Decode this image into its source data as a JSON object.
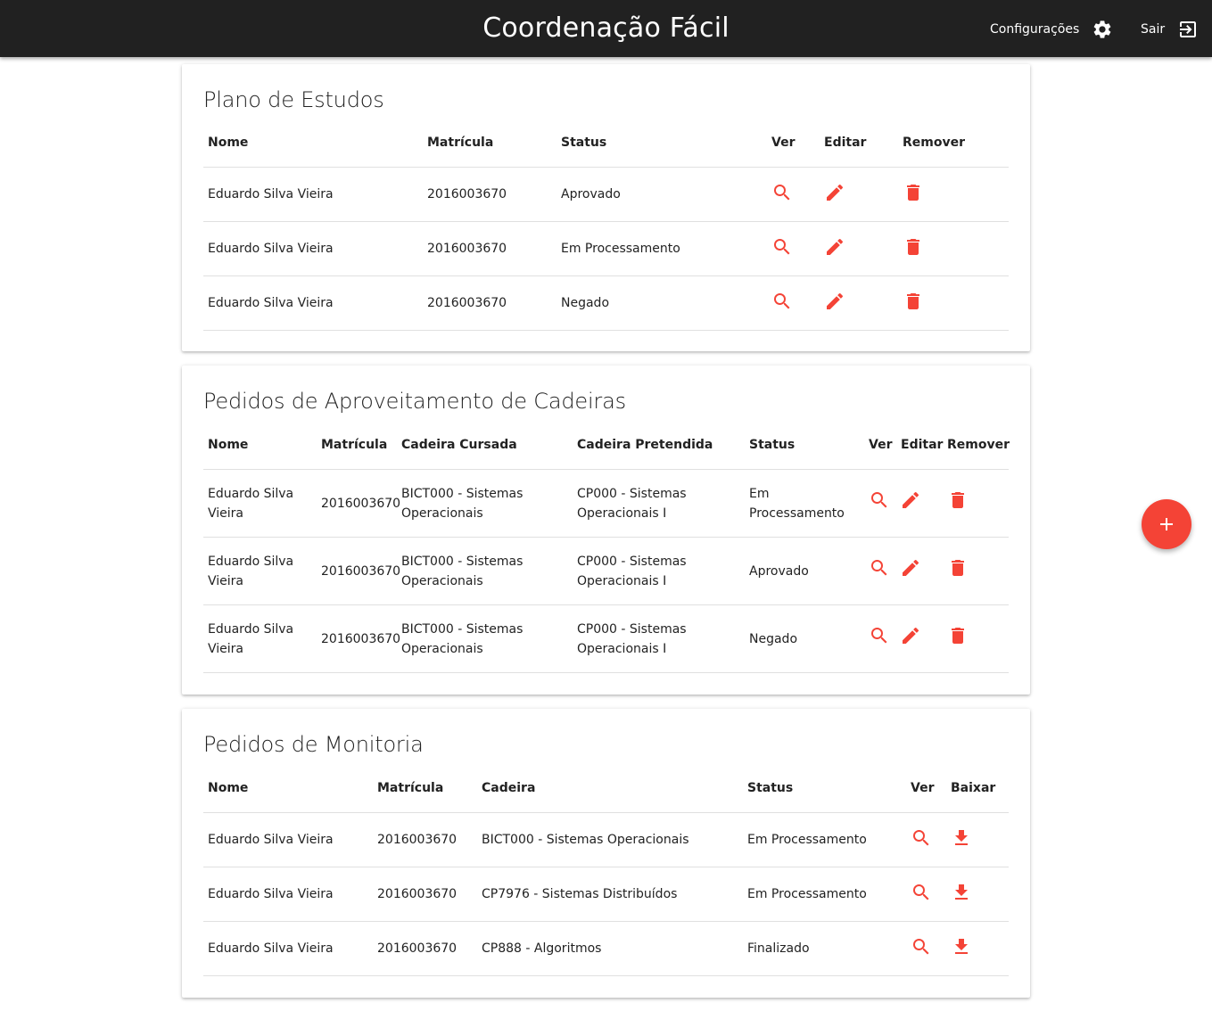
{
  "header": {
    "title": "Coordenação Fácil",
    "config_label": "Configurações",
    "logout_label": "Sair"
  },
  "plano": {
    "title": "Plano de Estudos",
    "headers": [
      "Nome",
      "Matrícula",
      "Status",
      "Ver",
      "Editar",
      "Remover"
    ],
    "rows": [
      {
        "nome": "Eduardo Silva Vieira",
        "matricula": "2016003670",
        "status": "Aprovado"
      },
      {
        "nome": "Eduardo Silva Vieira",
        "matricula": "2016003670",
        "status": "Em Processamento"
      },
      {
        "nome": "Eduardo Silva Vieira",
        "matricula": "2016003670",
        "status": "Negado"
      }
    ]
  },
  "aproveitamento": {
    "title": "Pedidos de Aproveitamento de Cadeiras",
    "headers": [
      "Nome",
      "Matrícula",
      "Cadeira Cursada",
      "Cadeira Pretendida",
      "Status",
      "Ver",
      "Editar",
      "Remover"
    ],
    "rows": [
      {
        "nome": "Eduardo Silva Vieira",
        "matricula": "2016003670",
        "cursada": "BICT000 - Sistemas Operacionais",
        "pretendida": "CP000 - Sistemas Operacionais I",
        "status": "Em Processamento"
      },
      {
        "nome": "Eduardo Silva Vieira",
        "matricula": "2016003670",
        "cursada": "BICT000 - Sistemas Operacionais",
        "pretendida": "CP000 - Sistemas Operacionais I",
        "status": "Aprovado"
      },
      {
        "nome": "Eduardo Silva Vieira",
        "matricula": "2016003670",
        "cursada": "BICT000 - Sistemas Operacionais",
        "pretendida": "CP000 - Sistemas Operacionais I",
        "status": "Negado"
      }
    ]
  },
  "monitoria": {
    "title": "Pedidos de Monitoria",
    "headers": [
      "Nome",
      "Matrícula",
      "Cadeira",
      "Status",
      "Ver",
      "Baixar"
    ],
    "rows": [
      {
        "nome": "Eduardo Silva Vieira",
        "matricula": "2016003670",
        "cadeira": "BICT000 - Sistemas Operacionais",
        "status": "Em Processamento"
      },
      {
        "nome": "Eduardo Silva Vieira",
        "matricula": "2016003670",
        "cadeira": "CP7976 - Sistemas Distribuídos",
        "status": "Em Processamento"
      },
      {
        "nome": "Eduardo Silva Vieira",
        "matricula": "2016003670",
        "cadeira": "CP888 - Algoritmos",
        "status": "Finalizado"
      }
    ]
  },
  "icons": {
    "config": "gear-icon",
    "logout": "exit-icon",
    "view": "search-icon",
    "edit": "pencil-icon",
    "remove": "trash-icon",
    "download": "download-icon",
    "add": "plus-icon"
  },
  "colors": {
    "accent": "#f44336",
    "topbar": "#212121"
  }
}
